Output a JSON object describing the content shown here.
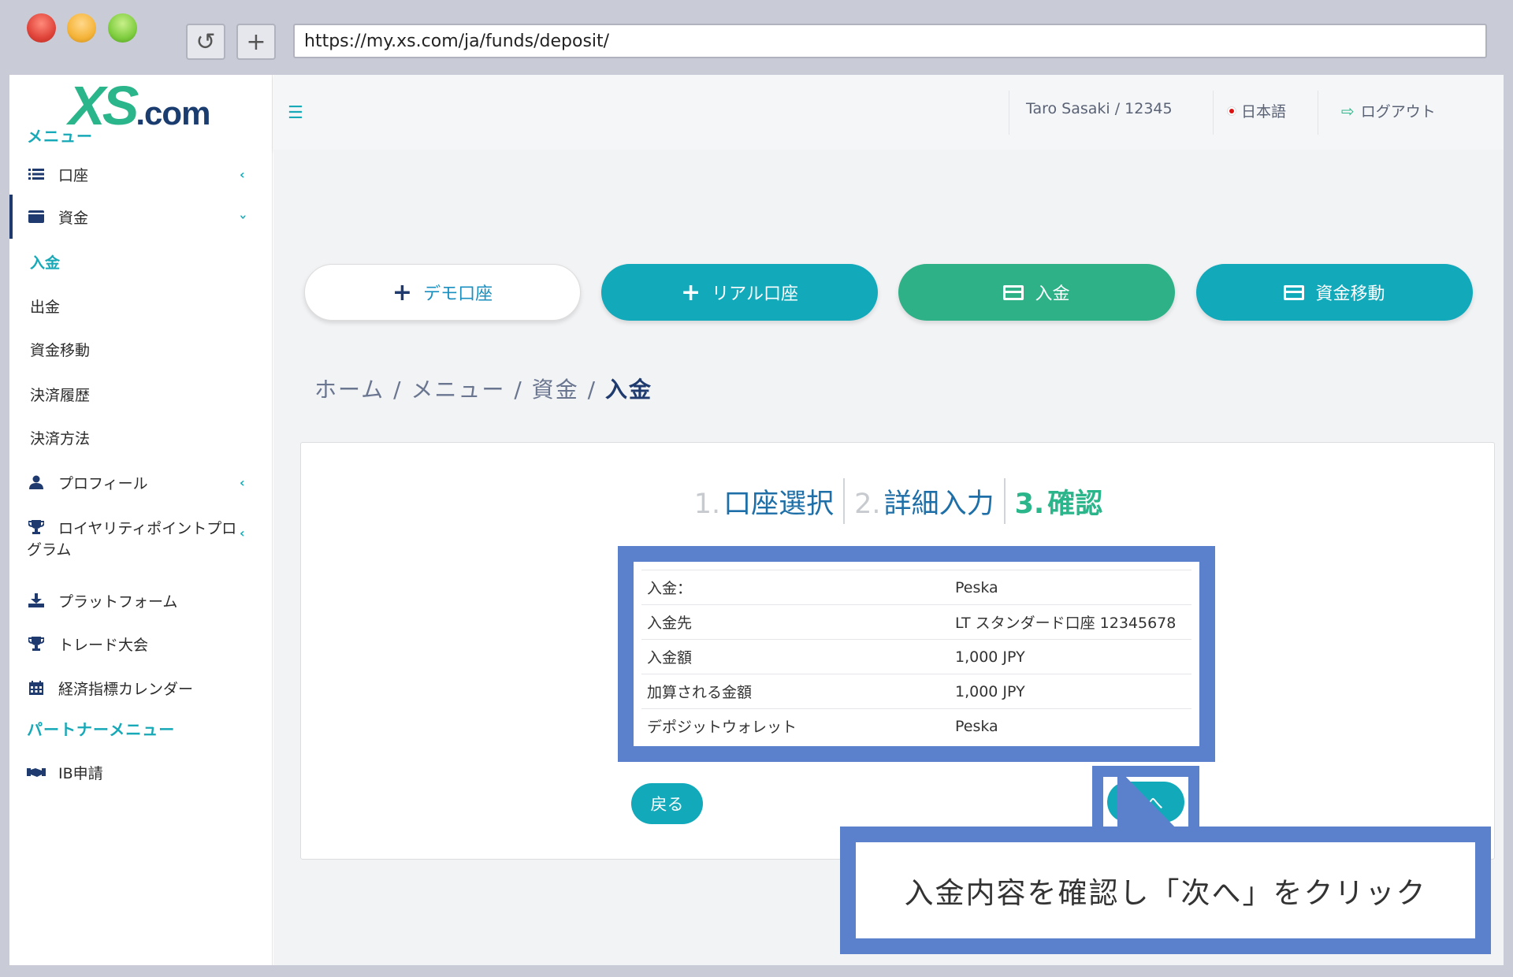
{
  "browser": {
    "url": "https://my.xs.com/ja/funds/deposit/",
    "reload_icon": "reload-icon",
    "newtab_icon": "plus-icon"
  },
  "logo": {
    "part1": "XS",
    "part2": ".com"
  },
  "sidebar": {
    "menu_heading": "メニュー",
    "items": [
      {
        "label": "口座",
        "icon": "list-icon"
      },
      {
        "label": "資金",
        "icon": "wallet-icon"
      },
      {
        "label": "プロフィール",
        "icon": "user-icon"
      },
      {
        "label": "ロイヤリティポイントプログラム",
        "icon": "trophy-icon"
      },
      {
        "label": "プラットフォーム",
        "icon": "download-icon"
      },
      {
        "label": "トレード大会",
        "icon": "trophy-icon"
      },
      {
        "label": "経済指標カレンダー",
        "icon": "calendar-icon"
      }
    ],
    "funds_sub": [
      "入金",
      "出金",
      "資金移動",
      "決済履歴",
      "決済方法"
    ],
    "loyalty_line1": "ロイヤリティポイントプロ",
    "loyalty_line2": "グラム",
    "partner_heading": "パートナーメニュー",
    "partner_item": "IB申請"
  },
  "topbar": {
    "user": "Taro Sasaki / 12345",
    "language": "日本語",
    "logout": "ログアウト"
  },
  "actions": {
    "demo": "デモ口座",
    "real": "リアル口座",
    "deposit": "入金",
    "transfer": "資金移動"
  },
  "breadcrumb": {
    "home": "ホーム",
    "menu": "メニュー",
    "funds": "資金",
    "current": "入金",
    "sep": "/"
  },
  "steps": [
    {
      "num": "1.",
      "label": "口座選択"
    },
    {
      "num": "2.",
      "label": "詳細入力"
    },
    {
      "num": "3.",
      "label": "確認"
    }
  ],
  "confirm_rows": [
    {
      "key": "入金：",
      "value": "Peska"
    },
    {
      "key": "入金先",
      "value": "LT スタンダード口座 12345678"
    },
    {
      "key": "入金額",
      "value": "1,000 JPY"
    },
    {
      "key": "加算される金額",
      "value": "1,000 JPY"
    },
    {
      "key": "デポジットウォレット",
      "value": "Peska"
    }
  ],
  "buttons": {
    "back": "戻る",
    "next": "次へ"
  },
  "callout": "入金内容を確認し「次へ」をクリック",
  "colors": {
    "teal": "#12a9bb",
    "green": "#2bb58a",
    "navy": "#1e3a6e",
    "highlight": "#5b80cc"
  }
}
